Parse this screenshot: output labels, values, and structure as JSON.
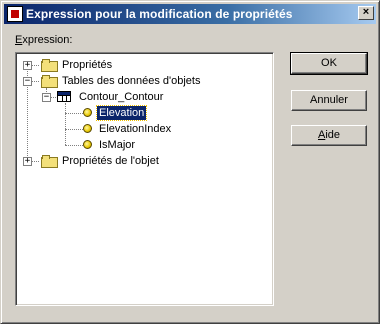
{
  "window": {
    "title": "Expression pour la modification de propriétés",
    "close_glyph": "×"
  },
  "expression": {
    "label_mnemonic": "E",
    "label_rest": "xpression:"
  },
  "tree": {
    "items": [
      {
        "label": "Propriétés",
        "expander": "+",
        "icon": "folder-icon"
      },
      {
        "label": "Tables des données d'objets",
        "expander": "−",
        "icon": "folder-open-icon"
      },
      {
        "label": "Contour_Contour",
        "expander": "−",
        "icon": "table-icon"
      },
      {
        "label": "Elevation",
        "icon": "field-icon",
        "selected": true
      },
      {
        "label": "ElevationIndex",
        "icon": "field-icon"
      },
      {
        "label": "IsMajor",
        "icon": "field-icon"
      },
      {
        "label": "Propriétés de l'objet",
        "expander": "+",
        "icon": "folder-icon"
      }
    ]
  },
  "buttons": {
    "ok": "OK",
    "cancel": "Annuler",
    "help_mnemonic": "A",
    "help_rest": "ide"
  }
}
